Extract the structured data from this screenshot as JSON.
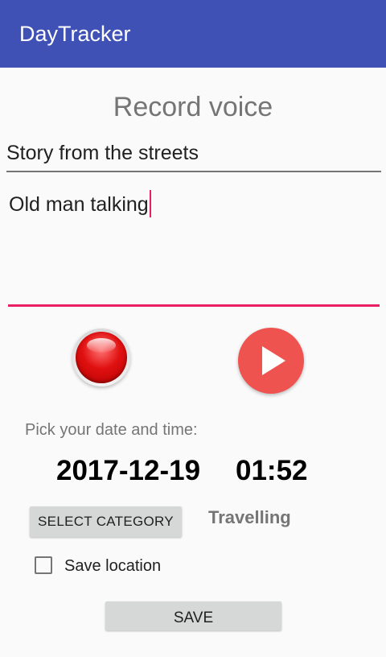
{
  "app_bar": {
    "title": "DayTracker",
    "background": "#3f51b5"
  },
  "page": {
    "heading": "Record voice"
  },
  "form": {
    "title_value": "Story from the streets",
    "description_value": "Old man talking",
    "focused_field": "description",
    "accent_color": "#e91e63"
  },
  "controls": {
    "record_icon": "record-icon",
    "play_icon": "play-icon",
    "play_color": "#ef5350"
  },
  "datetime": {
    "label": "Pick your date and time:",
    "date": "2017-12-19",
    "time": "01:52"
  },
  "category": {
    "button_label": "SELECT CATEGORY",
    "selected": "Travelling"
  },
  "save_location": {
    "label": "Save location",
    "checked": false
  },
  "actions": {
    "save_label": "SAVE"
  }
}
